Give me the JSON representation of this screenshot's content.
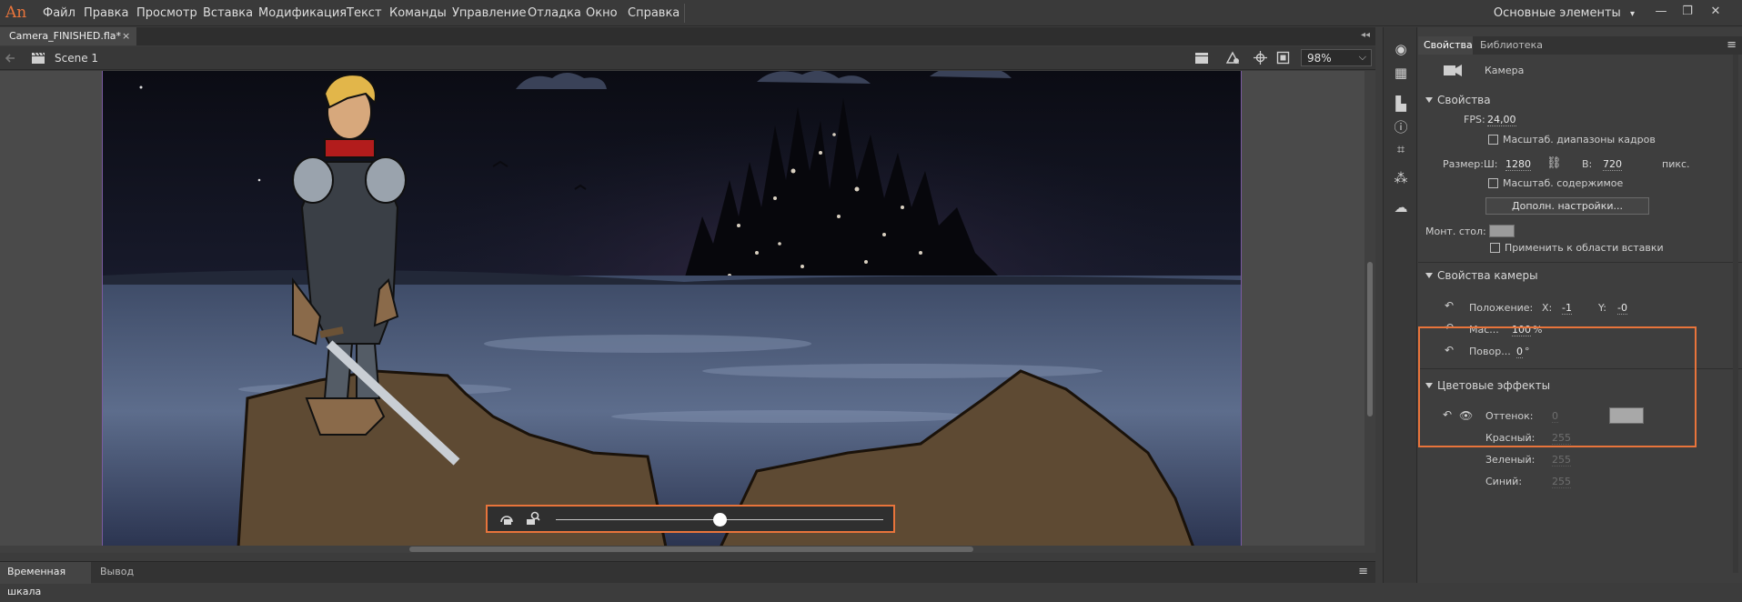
{
  "app": {
    "logo": "An"
  },
  "menu": [
    "Файл",
    "Правка",
    "Просмотр",
    "Вставка",
    "Модификация",
    "Текст",
    "Команды",
    "Управление",
    "Отладка",
    "Окно",
    "Справка"
  ],
  "workspace": {
    "label": "Основные элементы",
    "caret": "▾"
  },
  "window_controls": {
    "minimize": "—",
    "restore": "❐",
    "close": "✕"
  },
  "document": {
    "tab_title": "Camera_FINISHED.fla*",
    "close": "×",
    "scene": "Scene 1",
    "zoom": "98%"
  },
  "camera_bar": {
    "zoom_position": 0.5
  },
  "bottom_tabs": {
    "timeline": "Временная шкала",
    "output": "Вывод"
  },
  "panel": {
    "tabs": {
      "properties": "Свойства",
      "library": "Библиотека"
    },
    "object_name": "Камера",
    "properties_section": {
      "title": "Свойства",
      "fps_label": "FPS:",
      "fps_value": "24,00",
      "scale_spans_label": "Масштаб. диапазоны кадров",
      "size_label": "Размер:",
      "w_label": "Ш:",
      "w_value": "1280",
      "h_label": "В:",
      "h_value": "720",
      "units": "пикс.",
      "scale_content_label": "Масштаб. содержимое",
      "advanced_button": "Дополн. настройки...",
      "stage_label": "Монт. стол:",
      "stage_color": "#9b9b9b",
      "apply_paste_label": "Применить к области вставки"
    },
    "camera_section": {
      "title": "Свойства камеры",
      "position_label": "Положение:",
      "x_label": "X:",
      "x_value": "-1",
      "y_label": "Y:",
      "y_value": "-0",
      "scale_label": "Мас...",
      "scale_value": "100",
      "scale_unit": "%",
      "rotate_label": "Повор...",
      "rotate_value": "0",
      "rotate_unit": "°"
    },
    "color_section": {
      "title": "Цветовые эффекты",
      "tint_label": "Оттенок:",
      "tint_value": "0",
      "tint_color": "#a8a8a8",
      "red_label": "Красный:",
      "red_value": "255",
      "green_label": "Зеленый:",
      "green_value": "255",
      "blue_label": "Синий:",
      "blue_value": "255"
    }
  },
  "colors": {
    "accent": "#e8743b"
  }
}
